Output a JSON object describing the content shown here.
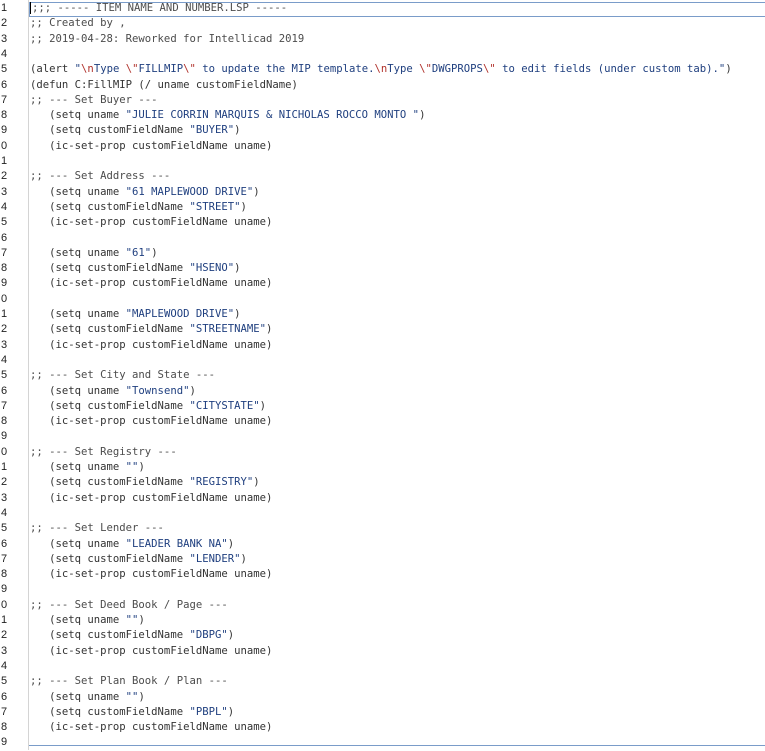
{
  "editor": {
    "line_numbers": [
      "1",
      "2",
      "3",
      "4",
      "5",
      "6",
      "7",
      "8",
      "9",
      "0",
      "1",
      "2",
      "3",
      "4",
      "5",
      "6",
      "7",
      "8",
      "9",
      "0",
      "1",
      "2",
      "3",
      "4",
      "5",
      "6",
      "7",
      "8",
      "9",
      "0",
      "1",
      "2",
      "3",
      "4",
      "5",
      "6",
      "7",
      "8",
      "9",
      "0",
      "1",
      "2",
      "3",
      "4",
      "5",
      "6",
      "7",
      "8",
      "9"
    ],
    "lines": [
      ";;; ----- ITEM NAME AND NUMBER.LSP -----",
      ";; Created by ,",
      ";; 2019-04-28: Reworked for Intellicad 2019",
      "",
      "(alert \"\\nType \\\"FILLMIP\\\" to update the MIP template.\\nType \\\"DWGPROPS\\\" to edit fields (under custom tab).\")",
      "(defun C:FillMIP (/ uname customFieldName)",
      ";; --- Set Buyer ---",
      "   (setq uname \"JULIE CORRIN MARQUIS & NICHOLAS ROCCO MONTO \")",
      "   (setq customFieldName \"BUYER\")",
      "   (ic-set-prop customFieldName uname)",
      "",
      ";; --- Set Address ---",
      "   (setq uname \"61 MAPLEWOOD DRIVE\")",
      "   (setq customFieldName \"STREET\")",
      "   (ic-set-prop customFieldName uname)",
      "",
      "   (setq uname \"61\")",
      "   (setq customFieldName \"HSENO\")",
      "   (ic-set-prop customFieldName uname)",
      "",
      "   (setq uname \"MAPLEWOOD DRIVE\")",
      "   (setq customFieldName \"STREETNAME\")",
      "   (ic-set-prop customFieldName uname)",
      "",
      ";; --- Set City and State ---",
      "   (setq uname \"Townsend\")",
      "   (setq customFieldName \"CITYSTATE\")",
      "   (ic-set-prop customFieldName uname)",
      "",
      ";; --- Set Registry ---",
      "   (setq uname \"\")",
      "   (setq customFieldName \"REGISTRY\")",
      "   (ic-set-prop customFieldName uname)",
      "",
      ";; --- Set Lender ---",
      "   (setq uname \"LEADER BANK NA\")",
      "   (setq customFieldName \"LENDER\")",
      "   (ic-set-prop customFieldName uname)",
      "",
      ";; --- Set Deed Book / Page ---",
      "   (setq uname \"\")",
      "   (setq customFieldName \"DBPG\")",
      "   (ic-set-prop customFieldName uname)",
      "",
      ";; --- Set Plan Book / Plan ---",
      "   (setq uname \"\")",
      "   (setq customFieldName \"PBPL\")",
      "   (ic-set-prop customFieldName uname)",
      ""
    ]
  },
  "colors": {
    "comment": "#4c4c4c",
    "string": "#1f3f7f",
    "escape": "#b0312b",
    "text": "#333333",
    "ruler": "#7a9cc9"
  }
}
